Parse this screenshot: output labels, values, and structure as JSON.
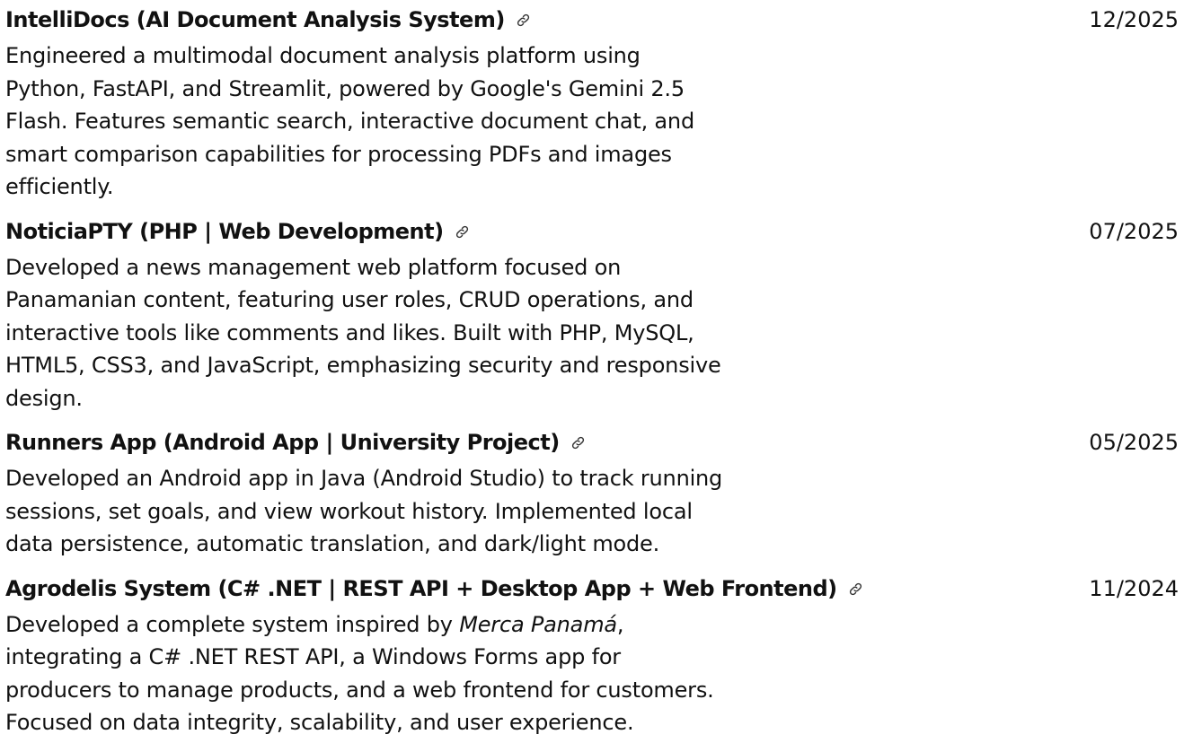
{
  "projects": [
    {
      "title": "IntelliDocs (AI Document Analysis System)",
      "date": "12/2025",
      "desc_before": "Engineered a multimodal document analysis platform using Python, FastAPI, and Streamlit, powered by Google's Gemini 2.5 Flash. Features semantic search, interactive document chat, and smart comparison capabilities for processing PDFs and images efficiently.",
      "link_icon": "link-icon"
    },
    {
      "title": "NoticiaPTY (PHP | Web Development)",
      "date": "07/2025",
      "desc_before": "Developed a news management web platform focused on Panamanian content, featuring user roles, CRUD operations, and interactive tools like comments and likes. Built with PHP, MySQL, HTML5, CSS3, and JavaScript, emphasizing security and responsive design.",
      "link_icon": "link-icon"
    },
    {
      "title": "Runners App (Android App | University Project)",
      "date": "05/2025",
      "desc_before": "Developed an Android app in Java (Android Studio) to track running sessions, set goals, and view workout history. Implemented local data persistence, automatic translation, and dark/light mode.",
      "link_icon": "link-icon"
    },
    {
      "title": "Agrodelis System (C# .NET | REST API + Desktop App + Web Frontend)",
      "date": "11/2024",
      "desc_before": "Developed a complete system inspired by ",
      "desc_italic": "Merca Panamá",
      "desc_after": ", integrating a C# .NET REST API, a Windows Forms app for producers to manage products, and a web frontend for customers. Focused on data integrity, scalability, and user experience.",
      "link_icon": "link-icon"
    }
  ]
}
